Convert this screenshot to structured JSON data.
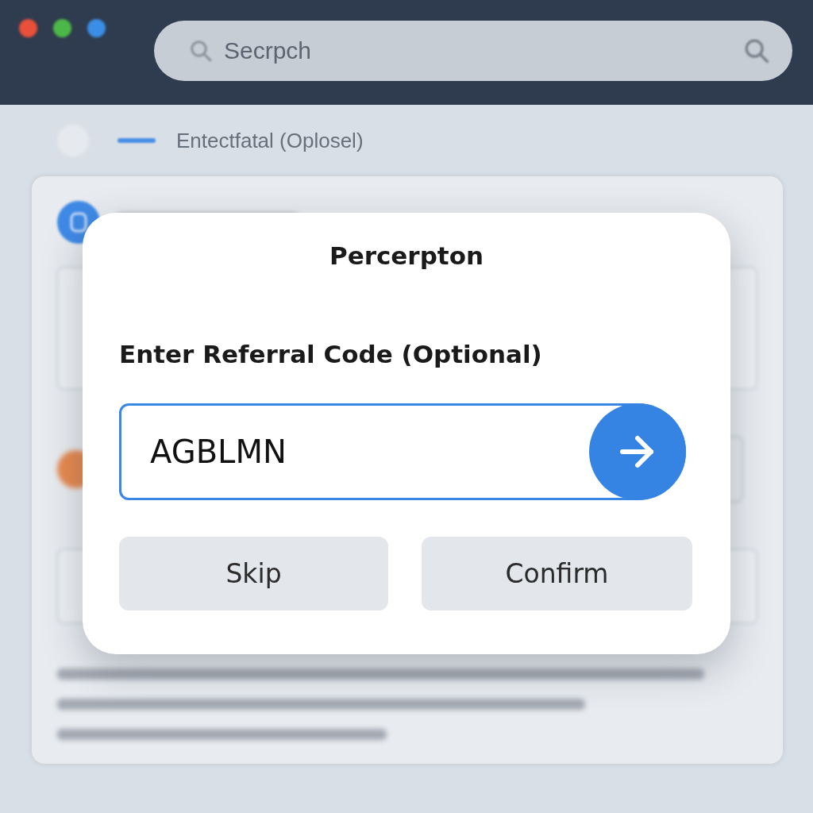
{
  "window": {
    "controls": [
      {
        "color": "#e8503a"
      },
      {
        "color": "#4cb848"
      },
      {
        "color": "#3a8ee6"
      }
    ]
  },
  "search": {
    "placeholder": "Secrpch"
  },
  "step": {
    "label": "Entectfatal (Oplosel)"
  },
  "dialog": {
    "title": "Percerpton",
    "field_label": "Enter Referral Code (Optional)",
    "code_field": {
      "value": "AGBLMN"
    },
    "buttons": [
      {
        "label": "Skip"
      },
      {
        "label": "Confirm"
      }
    ]
  }
}
